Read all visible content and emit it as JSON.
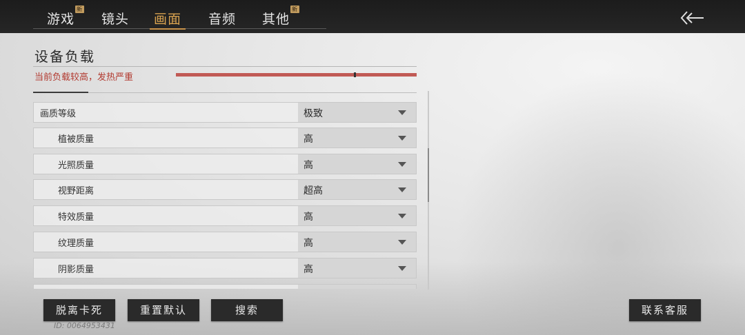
{
  "tabs": [
    {
      "label": "游戏",
      "badge": "新",
      "active": false
    },
    {
      "label": "镜头",
      "badge": "",
      "active": false
    },
    {
      "label": "画面",
      "badge": "",
      "active": true
    },
    {
      "label": "音频",
      "badge": "",
      "active": false
    },
    {
      "label": "其他",
      "badge": "新",
      "active": false
    }
  ],
  "section": {
    "title": "设备负载",
    "warning": "当前负载较高，发热严重"
  },
  "settings": [
    {
      "label": "画质等级",
      "value": "极致"
    },
    {
      "label": "植被质量",
      "value": "高"
    },
    {
      "label": "光照质量",
      "value": "高"
    },
    {
      "label": "视野距离",
      "value": "超高"
    },
    {
      "label": "特效质量",
      "value": "高"
    },
    {
      "label": "纹理质量",
      "value": "高"
    },
    {
      "label": "阴影质量",
      "value": "高"
    }
  ],
  "buttons": {
    "unstuck": "脱离卡死",
    "reset": "重置默认",
    "search": "搜索",
    "support": "联系客服"
  },
  "user_id": "ID: 0064953431",
  "colors": {
    "accent": "#d8a24f",
    "warning": "#b23a30",
    "load_bar": "#c15a55"
  }
}
